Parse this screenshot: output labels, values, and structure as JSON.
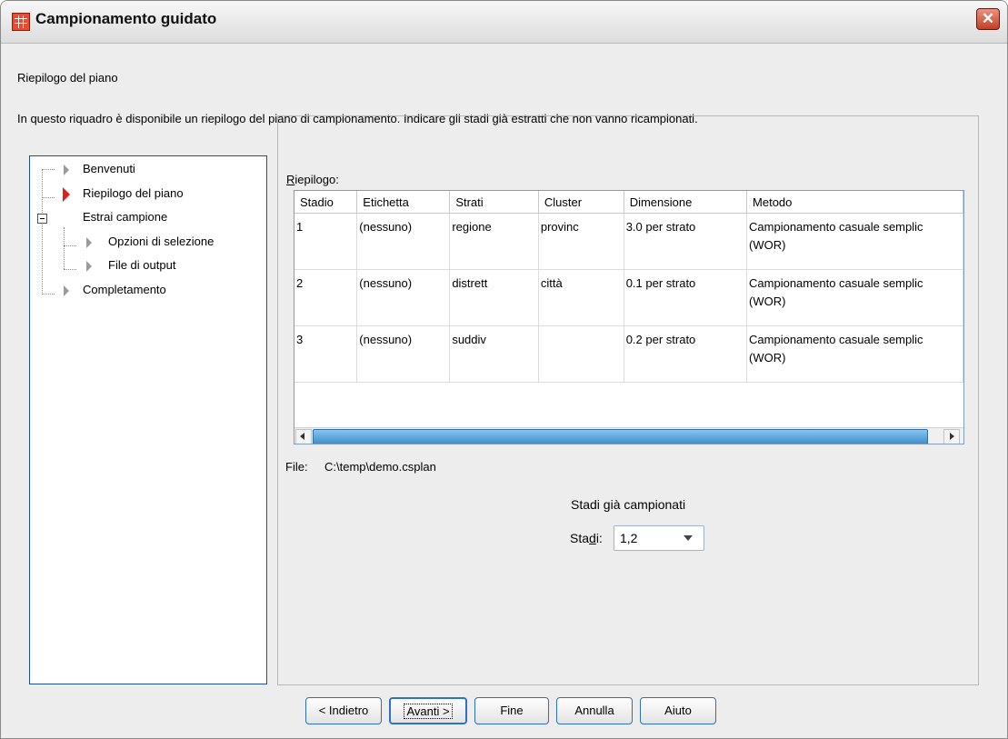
{
  "window": {
    "title": "Campionamento guidato",
    "close_label": "✕"
  },
  "heading": "Riepilogo del piano",
  "description": "In questo riquadro è disponibile un riepilogo del piano di campionamento. Indicare gli stadi già estratti che non vanno ricampionati.",
  "tree": {
    "items": [
      {
        "label": "Benvenuti"
      },
      {
        "label": "Riepilogo del piano"
      },
      {
        "label": "Estrai campione"
      },
      {
        "label": "Opzioni di selezione"
      },
      {
        "label": "File di output"
      },
      {
        "label": "Completamento"
      }
    ]
  },
  "summary": {
    "label": "Riepilogo:",
    "columns": [
      "Stadio",
      "Etichetta",
      "Strati",
      "Cluster",
      "Dimensione",
      "Metodo"
    ],
    "rows": [
      {
        "stadio": "1",
        "etichetta": "(nessuno)",
        "strati": "regione",
        "cluster": "provinc",
        "dimensione": "3.0 per strato",
        "metodo_line1": "Campionamento casuale semplic",
        "metodo_line2": "(WOR)"
      },
      {
        "stadio": "2",
        "etichetta": "(nessuno)",
        "strati": "distrett",
        "cluster": "città",
        "dimensione": "0.1 per strato",
        "metodo_line1": "Campionamento casuale semplic",
        "metodo_line2": "(WOR)"
      },
      {
        "stadio": "3",
        "etichetta": "(nessuno)",
        "strati": "suddiv",
        "cluster": "",
        "dimensione": "0.2 per strato",
        "metodo_line1": "Campionamento casuale semplic",
        "metodo_line2": "(WOR)"
      }
    ]
  },
  "file": {
    "label": "File:",
    "path": "C:\\temp\\demo.csplan"
  },
  "stages": {
    "group_title": "Stadi già campionati",
    "label": "Stadi:",
    "value": "1,2"
  },
  "buttons": {
    "back": "< Indietro",
    "next": "Avanti >",
    "finish": "Fine",
    "cancel": "Annulla",
    "help": "Aiuto"
  },
  "colors": {
    "accent_border": "#1a4f9c",
    "current_step_marker": "#e0201a",
    "close_button": "#c43d25",
    "scroll_thumb": "#3f8fcf"
  }
}
